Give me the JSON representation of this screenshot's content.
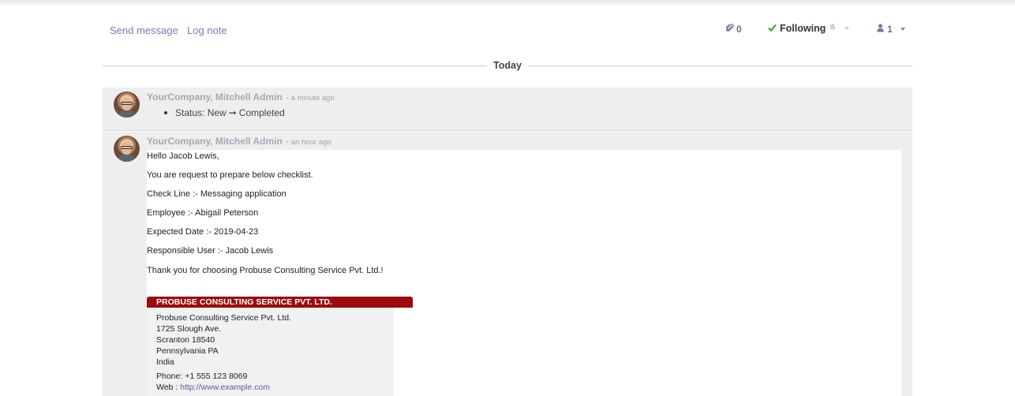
{
  "composer": {
    "send_message": "Send message",
    "log_note": "Log note"
  },
  "toolbar": {
    "attachments_count": "0",
    "following_label": "Following",
    "followers_count": "1"
  },
  "divider": {
    "label": "Today"
  },
  "messages": [
    {
      "author": "YourCompany, Mitchell Admin",
      "separator": "-",
      "time": "a minute ago",
      "tracking": {
        "field": "Status:",
        "old_value": "New",
        "arrow": "➞",
        "new_value": "Completed"
      }
    },
    {
      "author": "YourCompany, Mitchell Admin",
      "separator": "-",
      "time": "an hour ago",
      "lines": [
        "Hello Jacob Lewis,",
        "You are request to prepare below checklist.",
        "Check Line :- Messaging application",
        "Employee :- Abigail Peterson",
        "Expected Date :- 2019-04-23",
        "Responsible User :- Jacob Lewis",
        "Thank you for choosing Probuse Consulting Service Pvt. Ltd.!"
      ],
      "signature": {
        "header": "PROBUSE CONSULTING SERVICE PVT. LTD.",
        "company": "Probuse Consulting Service Pvt. Ltd.",
        "street": "1725 Slough Ave.",
        "city": "Scranton 18540",
        "state": "Pennsylvania PA",
        "country": "India",
        "phone": "Phone:  +1 555 123 8069",
        "web_label": "Web :",
        "web_url": "http://www.example.com"
      }
    }
  ],
  "colors": {
    "link": "#7c7bad",
    "signature_header": "#9b0b0b",
    "following_check": "#2aa02a"
  },
  "icons": [
    "paperclip-icon",
    "check-icon",
    "bell-icon",
    "user-icon",
    "caret-down-icon"
  ]
}
